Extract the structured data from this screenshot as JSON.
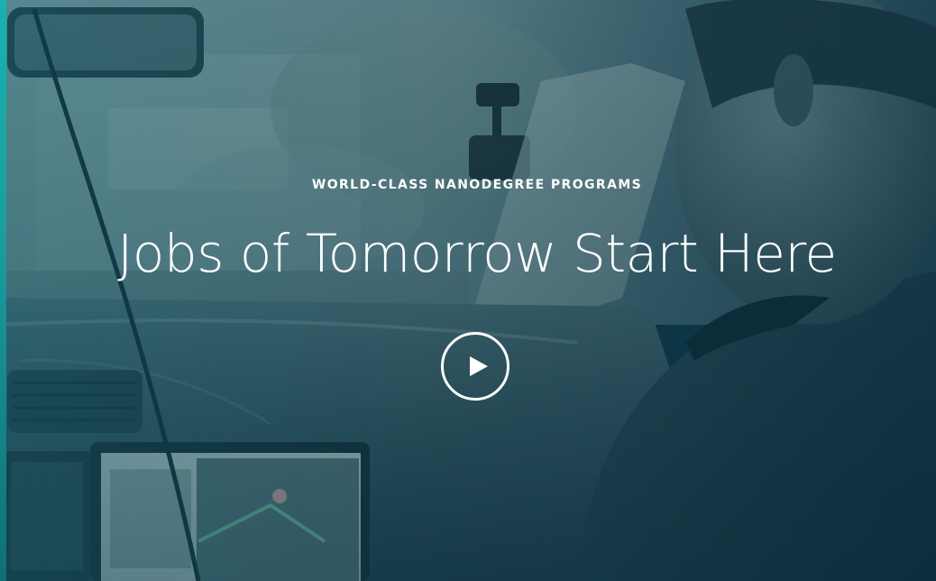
{
  "hero": {
    "eyebrow": "WORLD-CLASS NANODEGREE PROGRAMS",
    "headline": "Jobs of Tomorrow Start Here",
    "play_icon": "play-icon"
  },
  "colors": {
    "overlay_teal": "#0d3a49",
    "accent_teal": "#15b3b1",
    "text": "#ffffff"
  }
}
